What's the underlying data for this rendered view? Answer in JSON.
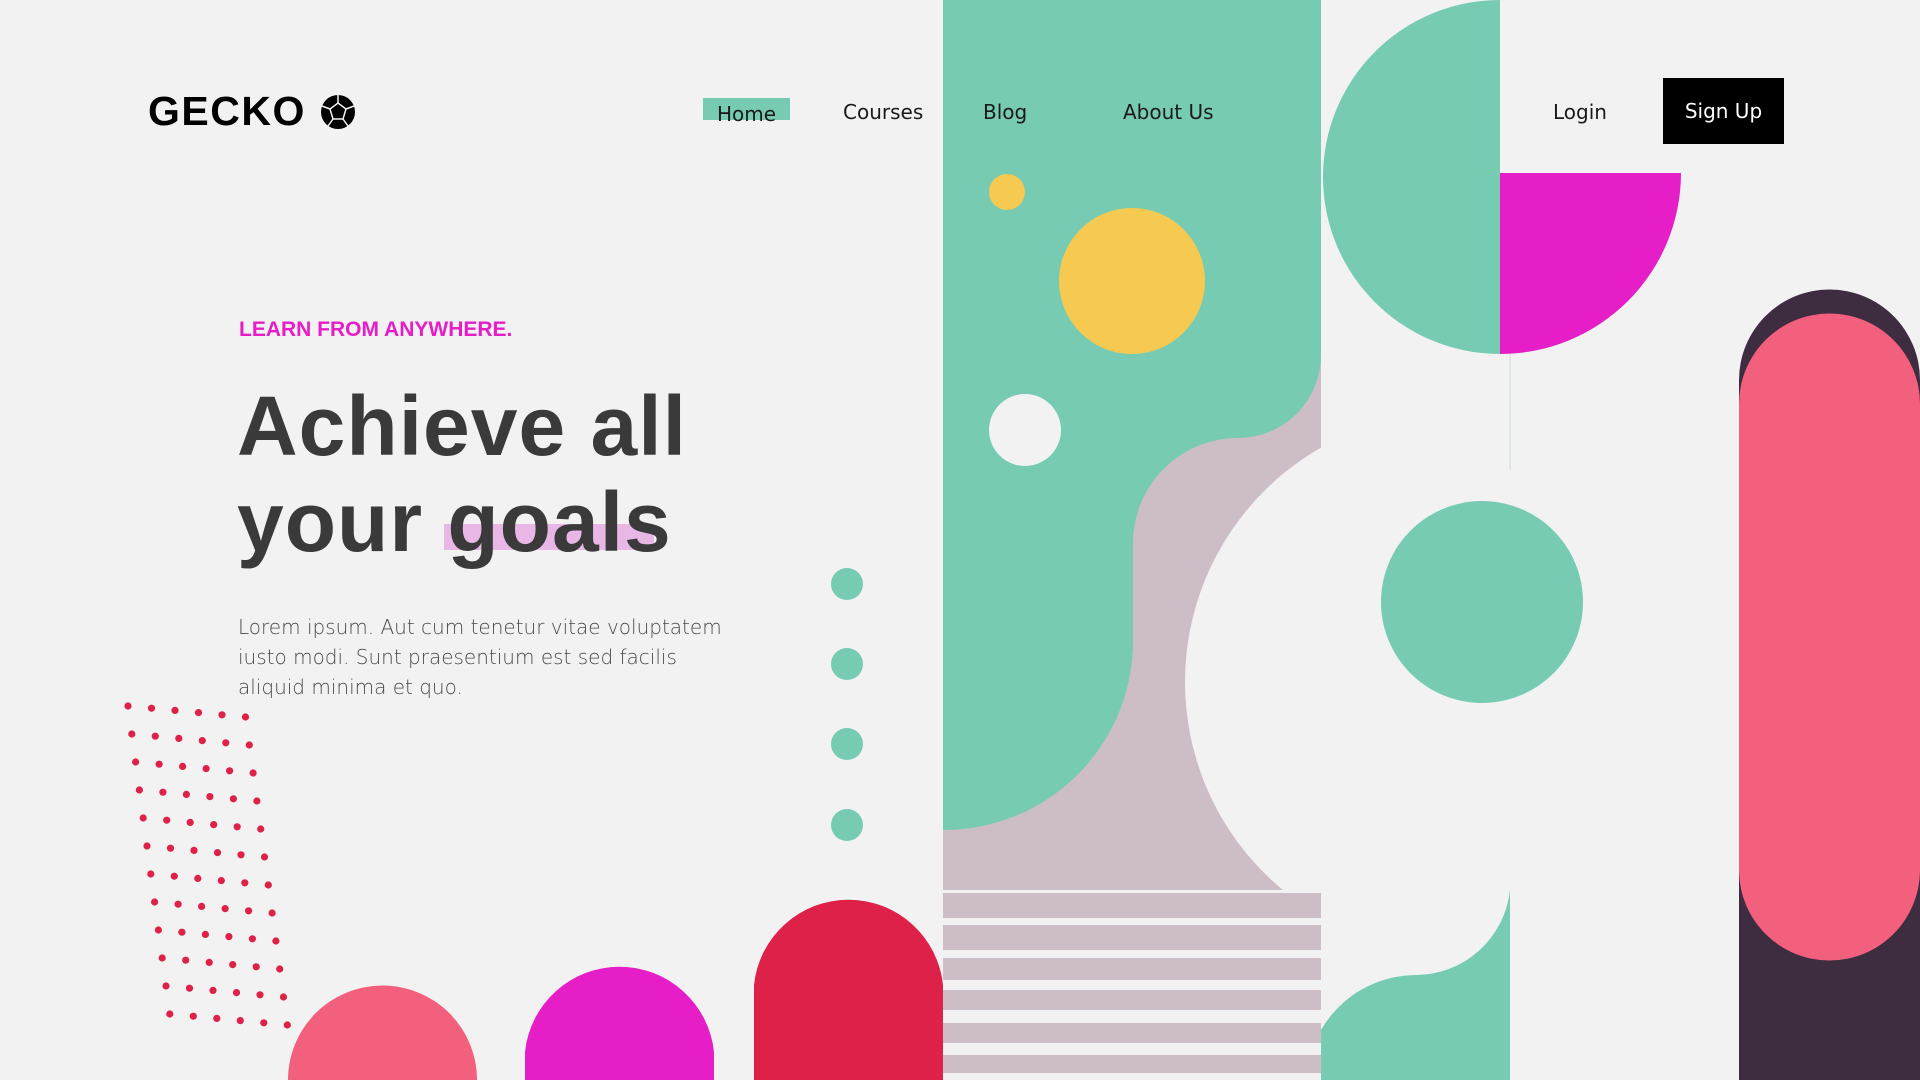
{
  "brand": {
    "name": "GECKO",
    "icon": "gem-icon"
  },
  "nav": {
    "items": [
      {
        "label": "Home",
        "active": true
      },
      {
        "label": "Courses"
      },
      {
        "label": "Blog"
      },
      {
        "label": "About Us"
      }
    ],
    "login": "Login",
    "signup": "Sign Up"
  },
  "hero": {
    "tagline": "LEARN FROM ANYWHERE.",
    "headline_line1": "Achieve all",
    "headline_line2": "your goals",
    "description": "Lorem ipsum. Aut cum tenetur vitae voluptatem iusto modi. Sunt praesentium est sed facilis aliquid minima et quo."
  },
  "colors": {
    "teal": "#77cbb3",
    "magenta": "#e51ec8",
    "crimson": "#dd2148",
    "pink": "#f3607d",
    "yellow": "#f6c951",
    "mauve": "#cdbdc6",
    "plum": "#3e2c41",
    "background": "#f2f2f2"
  }
}
